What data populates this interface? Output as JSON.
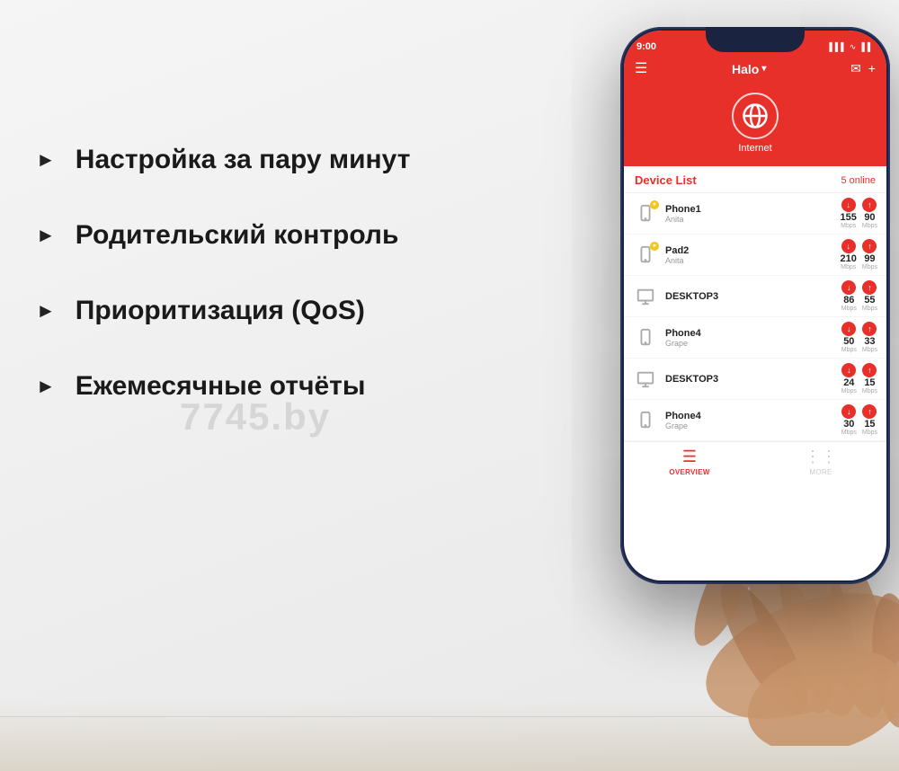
{
  "background": {
    "color": "#f0f0f0"
  },
  "watermark": "7745.by",
  "bullets": [
    {
      "id": "bullet1",
      "text": "Настройка за пару минут"
    },
    {
      "id": "bullet2",
      "text": "Родительский контроль"
    },
    {
      "id": "bullet3",
      "text": "Приоритизация (QoS)"
    },
    {
      "id": "bullet4",
      "text": "Ежемесячные отчёты"
    }
  ],
  "phone": {
    "statusBar": {
      "time": "9:00",
      "icons": "▌▌▌ WiFi ▐▐"
    },
    "header": {
      "menuIcon": "☰",
      "title": "Halo",
      "chevron": "▾",
      "mailIcon": "✉",
      "plusIcon": "+"
    },
    "internetSection": {
      "label": "Internet"
    },
    "deviceList": {
      "title": "Device List",
      "onlineText": "5 online",
      "devices": [
        {
          "name": "Phone1",
          "user": "Anita",
          "hasStarPhone": true,
          "hasStar": true,
          "type": "phone",
          "downSpeed": "155",
          "upSpeed": "90",
          "downUnit": "Mbps",
          "upUnit": "Mbps"
        },
        {
          "name": "Pad2",
          "user": "Anita",
          "hasStarPhone": true,
          "hasStar": true,
          "type": "tablet",
          "downSpeed": "210",
          "upSpeed": "99",
          "downUnit": "Mbps",
          "upUnit": "Mbps"
        },
        {
          "name": "DESKTOP3",
          "user": "",
          "hasStarPhone": false,
          "hasStar": false,
          "type": "desktop",
          "downSpeed": "86",
          "upSpeed": "55",
          "downUnit": "Mbps",
          "upUnit": "Mbps"
        },
        {
          "name": "Phone4",
          "user": "Grape",
          "hasStarPhone": false,
          "hasStar": false,
          "type": "phone",
          "downSpeed": "50",
          "upSpeed": "33",
          "downUnit": "Mbps",
          "upUnit": "Mbps"
        },
        {
          "name": "DESKTOP3",
          "user": "",
          "hasStarPhone": false,
          "hasStar": false,
          "type": "desktop",
          "downSpeed": "24",
          "upSpeed": "15",
          "downUnit": "Mbps",
          "upUnit": "Mbps"
        },
        {
          "name": "Phone4",
          "user": "Grape",
          "hasStarPhone": false,
          "hasStar": false,
          "type": "phone",
          "downSpeed": "30",
          "upSpeed": "15",
          "downUnit": "Mbps",
          "upUnit": "Mbps"
        }
      ]
    },
    "bottomNav": [
      {
        "label": "OVERVIEW",
        "active": true
      },
      {
        "label": "MORE",
        "active": false
      }
    ]
  }
}
